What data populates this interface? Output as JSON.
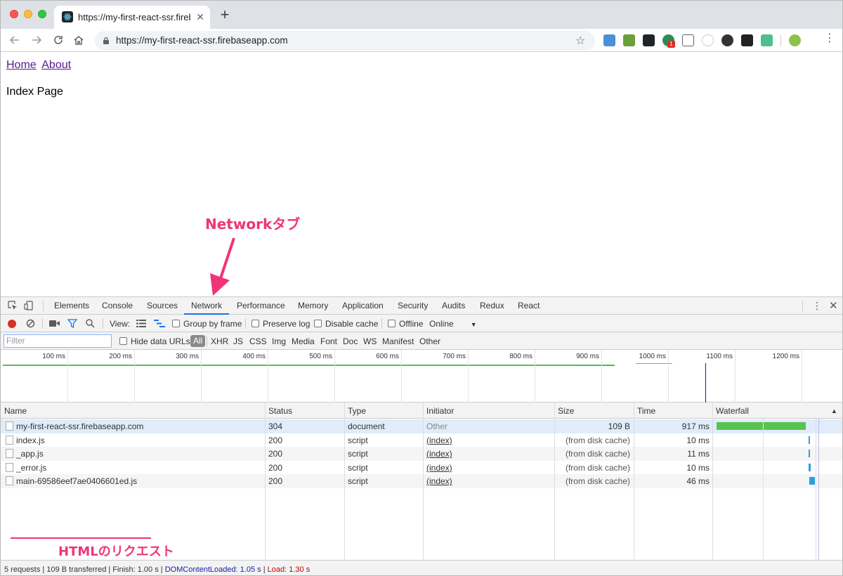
{
  "browser": {
    "tab_title": "https://my-first-react-ssr.fireb",
    "url": "https://my-first-react-ssr.firebaseapp.com",
    "extension_badge": "1"
  },
  "page": {
    "nav": [
      "Home",
      "About"
    ],
    "title": "Index Page"
  },
  "annotations": {
    "network_tab": "Networkタブ",
    "html_request": "HTMLのリクエスト"
  },
  "devtools": {
    "tabs": [
      "Elements",
      "Console",
      "Sources",
      "Network",
      "Performance",
      "Memory",
      "Application",
      "Security",
      "Audits",
      "Redux",
      "React"
    ],
    "active_tab": "Network",
    "toolbar": {
      "view_label": "View:",
      "group_by_frame": "Group by frame",
      "preserve_log": "Preserve log",
      "disable_cache": "Disable cache",
      "offline": "Offline",
      "throttle": "Online"
    },
    "filter_bar": {
      "placeholder": "Filter",
      "hide_data_urls": "Hide data URLs",
      "types": [
        "All",
        "XHR",
        "JS",
        "CSS",
        "Img",
        "Media",
        "Font",
        "Doc",
        "WS",
        "Manifest",
        "Other"
      ]
    },
    "overview_ticks": [
      "100 ms",
      "200 ms",
      "300 ms",
      "400 ms",
      "500 ms",
      "600 ms",
      "700 ms",
      "800 ms",
      "900 ms",
      "1000 ms",
      "1100 ms",
      "1200 ms"
    ],
    "columns": [
      "Name",
      "Status",
      "Type",
      "Initiator",
      "Size",
      "Time",
      "Waterfall"
    ],
    "requests": [
      {
        "name": "my-first-react-ssr.firebaseapp.com",
        "status": "304",
        "type": "document",
        "initiator": "Other",
        "size": "109 B",
        "time": "917 ms"
      },
      {
        "name": "index.js",
        "status": "200",
        "type": "script",
        "initiator": "(index)",
        "size": "(from disk cache)",
        "time": "10 ms"
      },
      {
        "name": "_app.js",
        "status": "200",
        "type": "script",
        "initiator": "(index)",
        "size": "(from disk cache)",
        "time": "11 ms"
      },
      {
        "name": "_error.js",
        "status": "200",
        "type": "script",
        "initiator": "(index)",
        "size": "(from disk cache)",
        "time": "10 ms"
      },
      {
        "name": "main-69586eef7ae0406601ed.js",
        "status": "200",
        "type": "script",
        "initiator": "(index)",
        "size": "(from disk cache)",
        "time": "46 ms"
      }
    ],
    "status_bar": {
      "summary": "5 requests | 109 B transferred | Finish: 1.00 s | ",
      "dcl": "DOMContentLoaded: 1.05 s",
      "sep": " | ",
      "load": "Load: 1.30 s"
    },
    "colors": {
      "dcl": "#1a1aa6",
      "load": "#c80000",
      "doc_bar": "#5ac34f",
      "script_bar": "#2c9fd8"
    }
  }
}
